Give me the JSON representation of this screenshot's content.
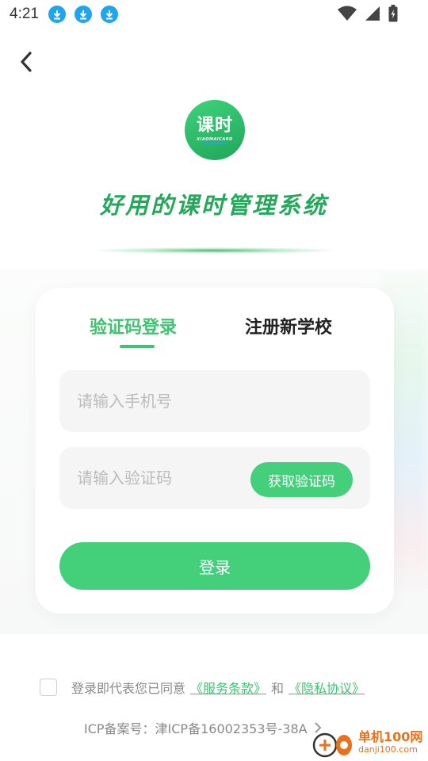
{
  "status_bar": {
    "time": "4:21",
    "icons": [
      "download-icon",
      "download-icon",
      "download-icon"
    ],
    "right_icons": [
      "wifi-icon",
      "signal-icon",
      "battery-icon"
    ]
  },
  "header": {
    "back_icon": "chevron-left-icon"
  },
  "logo": {
    "main_text": "课时",
    "sub_text": "XIAOMAICARD"
  },
  "slogan": "好用的课时管理系统",
  "tabs": [
    {
      "label": "验证码登录",
      "active": true
    },
    {
      "label": "注册新学校",
      "active": false
    }
  ],
  "form": {
    "phone_placeholder": "请输入手机号",
    "phone_value": "",
    "code_placeholder": "请输入验证码",
    "code_value": "",
    "get_code_label": "获取验证码",
    "login_label": "登录"
  },
  "agreement": {
    "checked": false,
    "prefix": "登录即代表您已同意",
    "terms_link": "《服务条款》",
    "conjunction": "和",
    "privacy_link": "《隐私协议》"
  },
  "icp": {
    "text": "ICP备案号：津ICP备16002353号-38A"
  },
  "watermark": {
    "brand": "单机100网",
    "url": "danji100.com"
  },
  "colors": {
    "accent": "#44cf7b",
    "accent_text": "#3cc46f",
    "slogan": "#24a85a",
    "download_badge": "#1ea5f0"
  }
}
